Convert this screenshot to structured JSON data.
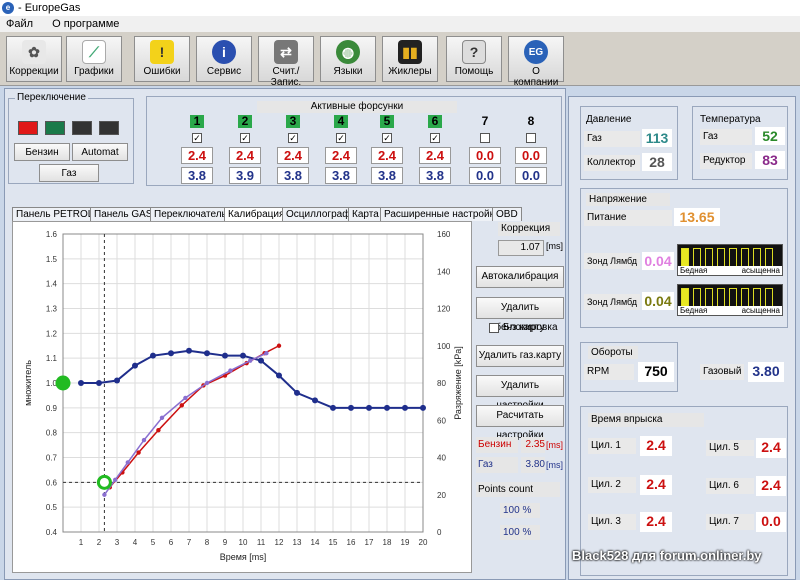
{
  "window": {
    "title": "- EuropeGas"
  },
  "menu": [
    "Файл",
    "О программе"
  ],
  "toolbar": [
    {
      "label": "Коррекции",
      "icon": "fan-icon"
    },
    {
      "label": "Графики",
      "icon": "chart-icon"
    },
    {
      "label": "Ошибки",
      "icon": "warning-icon"
    },
    {
      "label": "Сервис",
      "icon": "info-icon"
    },
    {
      "label": "Счит./Запис.",
      "icon": "read-write-icon"
    },
    {
      "label": "Языки",
      "icon": "globe-icon"
    },
    {
      "label": "Жиклеры",
      "icon": "jets-icon"
    },
    {
      "label": "Помощь",
      "icon": "help-icon"
    },
    {
      "label": "О компании",
      "icon": "eg-logo-icon"
    }
  ],
  "switch_group": {
    "caption": "Переключение",
    "colors": [
      "#e01818",
      "#1a7a4a",
      "#333333",
      "#333333"
    ],
    "benzin_btn": "Бензин",
    "automat_btn": "Automat",
    "gas_btn": "Газ"
  },
  "injectors": {
    "caption": "Активные форсунки",
    "items": [
      {
        "num": "1",
        "active": true,
        "checked": "✓",
        "a": "2.4",
        "b": "3.8"
      },
      {
        "num": "2",
        "active": true,
        "checked": "✓",
        "a": "2.4",
        "b": "3.9"
      },
      {
        "num": "3",
        "active": true,
        "checked": "✓",
        "a": "2.4",
        "b": "3.8"
      },
      {
        "num": "4",
        "active": true,
        "checked": "✓",
        "a": "2.4",
        "b": "3.8"
      },
      {
        "num": "5",
        "active": true,
        "checked": "✓",
        "a": "2.4",
        "b": "3.8"
      },
      {
        "num": "6",
        "active": true,
        "checked": "✓",
        "a": "2.4",
        "b": "3.8"
      },
      {
        "num": "7",
        "active": false,
        "checked": "",
        "a": "0.0",
        "b": "0.0"
      },
      {
        "num": "8",
        "active": false,
        "checked": "",
        "a": "0.0",
        "b": "0.0"
      }
    ]
  },
  "tabs": [
    "Панель PETROL",
    "Панель GAS",
    "Переключатель",
    "Калибрация",
    "Осциллограф",
    "Карта",
    "Расширенные настройки",
    "OBD"
  ],
  "active_tab": "Калибрация",
  "calibration": {
    "correction_label": "Коррекция",
    "correction_value": "1.07",
    "correction_unit": "[ms]",
    "buttons": [
      "Автокалибрация",
      "Удалить бенз.карту",
      "Удалить газ.карту",
      "Удалить настройки",
      "Расчитать настройки"
    ],
    "lock_label": "Блокировка",
    "benzin_label": "Бензин",
    "benzin_value": "2.35",
    "benzin_unit": "[ms]",
    "gas_label": "Газ",
    "gas_value": "3.80",
    "gas_unit": "[ms]",
    "points_label": "Points count",
    "pct1": "100 %",
    "pct2": "100 %"
  },
  "right": {
    "pressure_caption": "Давление",
    "pressure_gas_label": "Газ",
    "pressure_gas_value": "113",
    "pressure_coll_label": "Коллектор",
    "pressure_coll_value": "28",
    "temp_caption": "Температура",
    "temp_gas_label": "Газ",
    "temp_gas_value": "52",
    "temp_red_label": "Редуктор",
    "temp_red_value": "83",
    "voltage_caption": "Напряжение",
    "supply_label": "Питание",
    "supply_value": "13.65",
    "lambda1_label": "Зонд Лямбд",
    "lambda1_value": "0.04",
    "lambda2_label": "Зонд Лямбд",
    "lambda2_value": "0.04",
    "lambda_lean": "Бедная",
    "lambda_rich": "асыщенна",
    "rpm_caption": "Обороты",
    "rpm_label": "RPM",
    "rpm_value": "750",
    "gas_small_label": "Газовый",
    "gas_small_value": "3.80",
    "inj_time_caption": "Время впрыска",
    "cyl": [
      {
        "label": "Цил. 1",
        "value": "2.4"
      },
      {
        "label": "Цил. 2",
        "value": "2.4"
      },
      {
        "label": "Цил. 3",
        "value": "2.4"
      },
      {
        "label": "Цил. 5",
        "value": "2.4"
      },
      {
        "label": "Цил. 6",
        "value": "2.4"
      },
      {
        "label": "Цил. 7",
        "value": "0.0"
      }
    ]
  },
  "watermark": "Black528 для forum.onliner.by",
  "chart_data": {
    "type": "line",
    "xlabel": "Время [ms]",
    "ylabel": "множитель",
    "y2label": "Разряжение [kPa]",
    "xlim": [
      0,
      20
    ],
    "ylim": [
      0.4,
      1.6
    ],
    "y2lim": [
      0,
      160
    ],
    "x_ticks": [
      1,
      2,
      3,
      4,
      5,
      6,
      7,
      8,
      9,
      10,
      11,
      12,
      13,
      14,
      15,
      16,
      17,
      18,
      19,
      20
    ],
    "y_ticks": [
      "0.4",
      "0.5",
      "0.6",
      "0.7",
      "0.8",
      "0.9",
      "1.0",
      "1.1",
      "1.2",
      "1.3",
      "1.4",
      "1.5",
      "1.6"
    ],
    "y2_ticks": [
      "0",
      "20",
      "40",
      "60",
      "80",
      "100",
      "120",
      "140",
      "160"
    ],
    "series": [
      {
        "color": "#1f2e8c",
        "x": [
          1,
          2,
          3,
          4,
          5,
          6,
          7,
          8,
          9,
          10,
          11,
          12,
          13,
          14,
          15,
          16,
          17,
          18,
          19,
          20
        ],
        "y": [
          1.0,
          1.0,
          1.01,
          1.07,
          1.11,
          1.12,
          1.13,
          1.12,
          1.11,
          1.11,
          1.09,
          1.03,
          0.96,
          0.93,
          0.9,
          0.9,
          0.9,
          0.9,
          0.9,
          0.9
        ]
      },
      {
        "color": "#cc1010",
        "x": [
          2.6,
          3.3,
          4.2,
          5.3,
          6.6,
          7.8,
          9.0,
          10.2,
          11.2,
          12.0
        ],
        "y": [
          0.58,
          0.64,
          0.72,
          0.81,
          0.91,
          0.99,
          1.03,
          1.08,
          1.12,
          1.15
        ]
      },
      {
        "color": "#8a6fd0",
        "x": [
          2.3,
          2.9,
          3.6,
          4.5,
          5.5,
          6.8,
          8.0,
          9.3,
          10.4,
          11.3
        ],
        "y": [
          0.55,
          0.61,
          0.68,
          0.77,
          0.86,
          0.94,
          1.0,
          1.05,
          1.09,
          1.12
        ]
      }
    ],
    "markers": [
      {
        "x": 0.0,
        "y": 1.0,
        "color": "#22bb22"
      },
      {
        "x": 2.3,
        "y": 0.6,
        "color": "#22bb22"
      }
    ],
    "cursor_x": 2.3,
    "cursor_y": 0.6
  }
}
